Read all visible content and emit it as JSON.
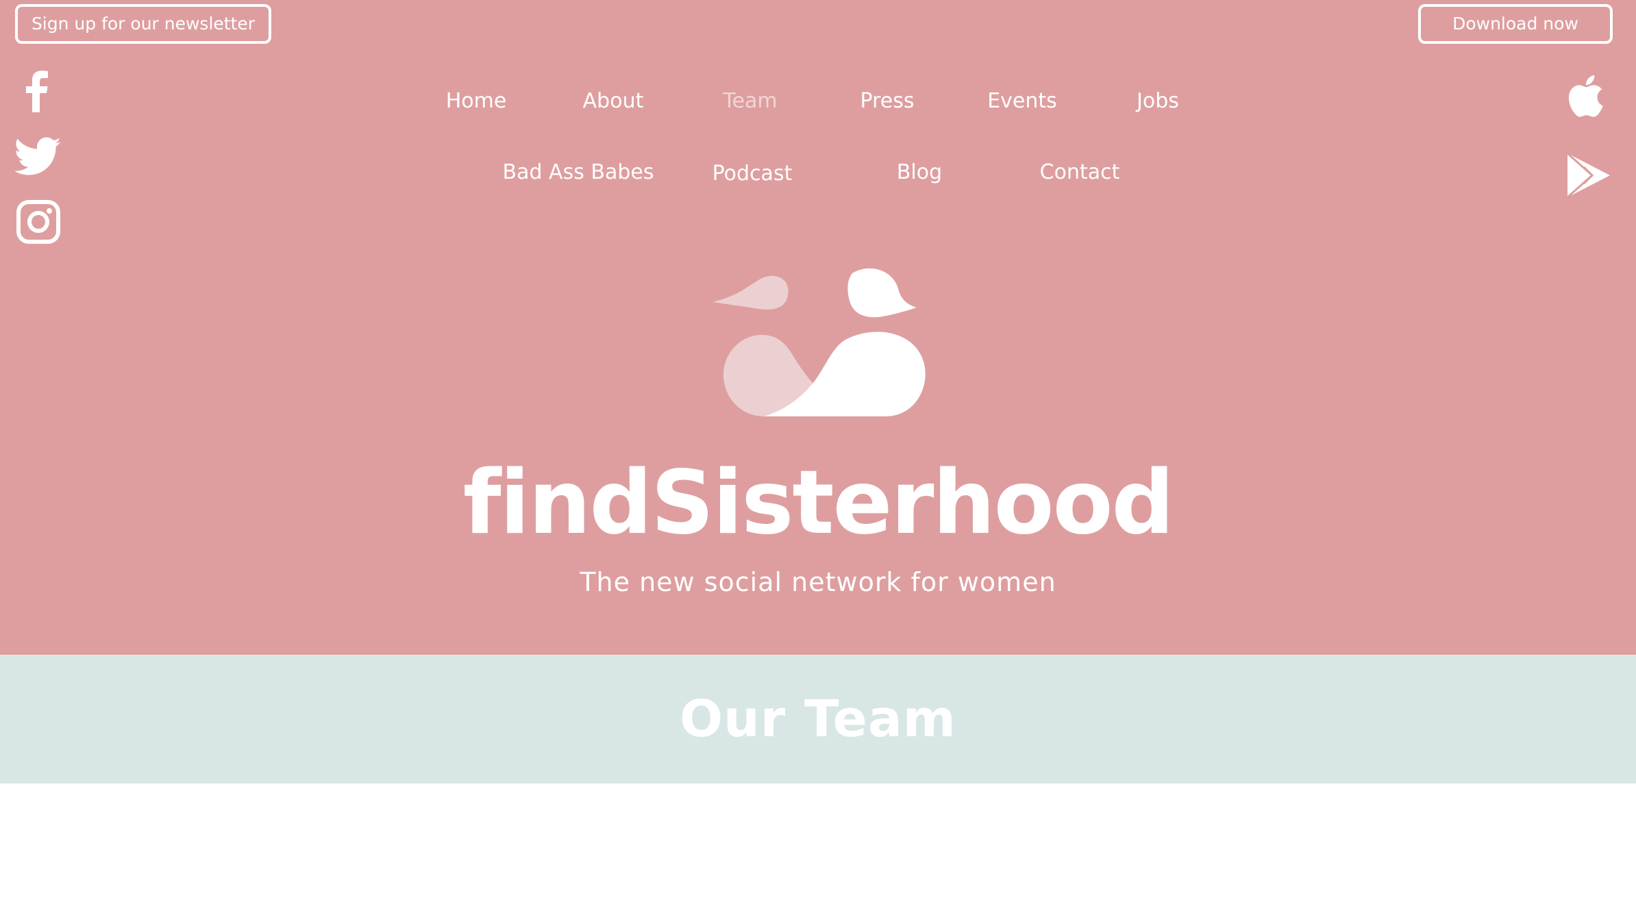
{
  "header": {
    "newsletter_button": "Sign up for our newsletter",
    "download_button": "Download now"
  },
  "social": {
    "icons": [
      "facebook-icon",
      "twitter-icon",
      "instagram-icon"
    ]
  },
  "stores": {
    "icons": [
      "apple-icon",
      "google-play-icon"
    ]
  },
  "nav": {
    "row1": [
      "Home",
      "About",
      "Team",
      "Press",
      "Events",
      "Jobs"
    ],
    "row2": [
      "Bad Ass Babes",
      "Podcast",
      "Blog",
      "Contact"
    ],
    "active": "Team"
  },
  "hero": {
    "brand": "findSisterhood",
    "tagline": "The new social network for women"
  },
  "team_section": {
    "title": "Our Team"
  },
  "colors": {
    "hero_background": "#de9e9f",
    "team_background": "#d8e7e6",
    "text": "#ffffff",
    "active_nav": "#f2d5d6"
  }
}
